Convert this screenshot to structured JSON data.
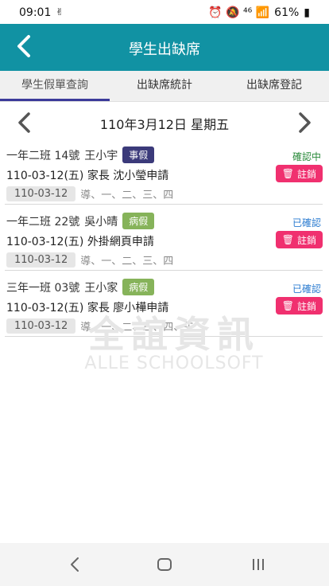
{
  "status_bar": {
    "time": "09:01",
    "left_icons": "✌",
    "right_icons": "⏰ 🔕 ⁴⁶ 📶",
    "battery": "61%"
  },
  "app_bar": {
    "title": "學生出缺席"
  },
  "tabs": [
    {
      "label": "學生假單查詢",
      "active": true
    },
    {
      "label": "出缺席統計",
      "active": false
    },
    {
      "label": "出缺席登記",
      "active": false
    }
  ],
  "date_nav": {
    "date": "110年3月12日 星期五"
  },
  "records": [
    {
      "class_no": "一年二班 14號",
      "name": "王小宇",
      "leave_type": "事假",
      "leave_color": "#3b3a7a",
      "status": "確認中",
      "status_color": "#2a8a3a",
      "request": "110-03-12(五)  家長 沈小瑩申請",
      "cancel": "註銷",
      "date_pill": "110-03-12",
      "periods": "導、一、二、三、四"
    },
    {
      "class_no": "一年二班 22號",
      "name": "吳小晴",
      "leave_type": "病假",
      "leave_color": "#86b35a",
      "status": "已確認",
      "status_color": "#2a7bd0",
      "request": "110-03-12(五)   外掛網頁申請",
      "cancel": "註銷",
      "date_pill": "110-03-12",
      "periods": "導、一、二、三、四"
    },
    {
      "class_no": "三年一班 03號",
      "name": "王小家",
      "leave_type": "病假",
      "leave_color": "#86b35a",
      "status": "已確認",
      "status_color": "#2a7bd0",
      "request": "110-03-12(五)  家長 廖小樺申請",
      "cancel": "註銷",
      "date_pill": "110-03-12",
      "periods": "導、一、二、三、四、午"
    }
  ],
  "watermark": {
    "line1": "全誼資訊",
    "line2": "ALLE SCHOOLSOFT"
  }
}
